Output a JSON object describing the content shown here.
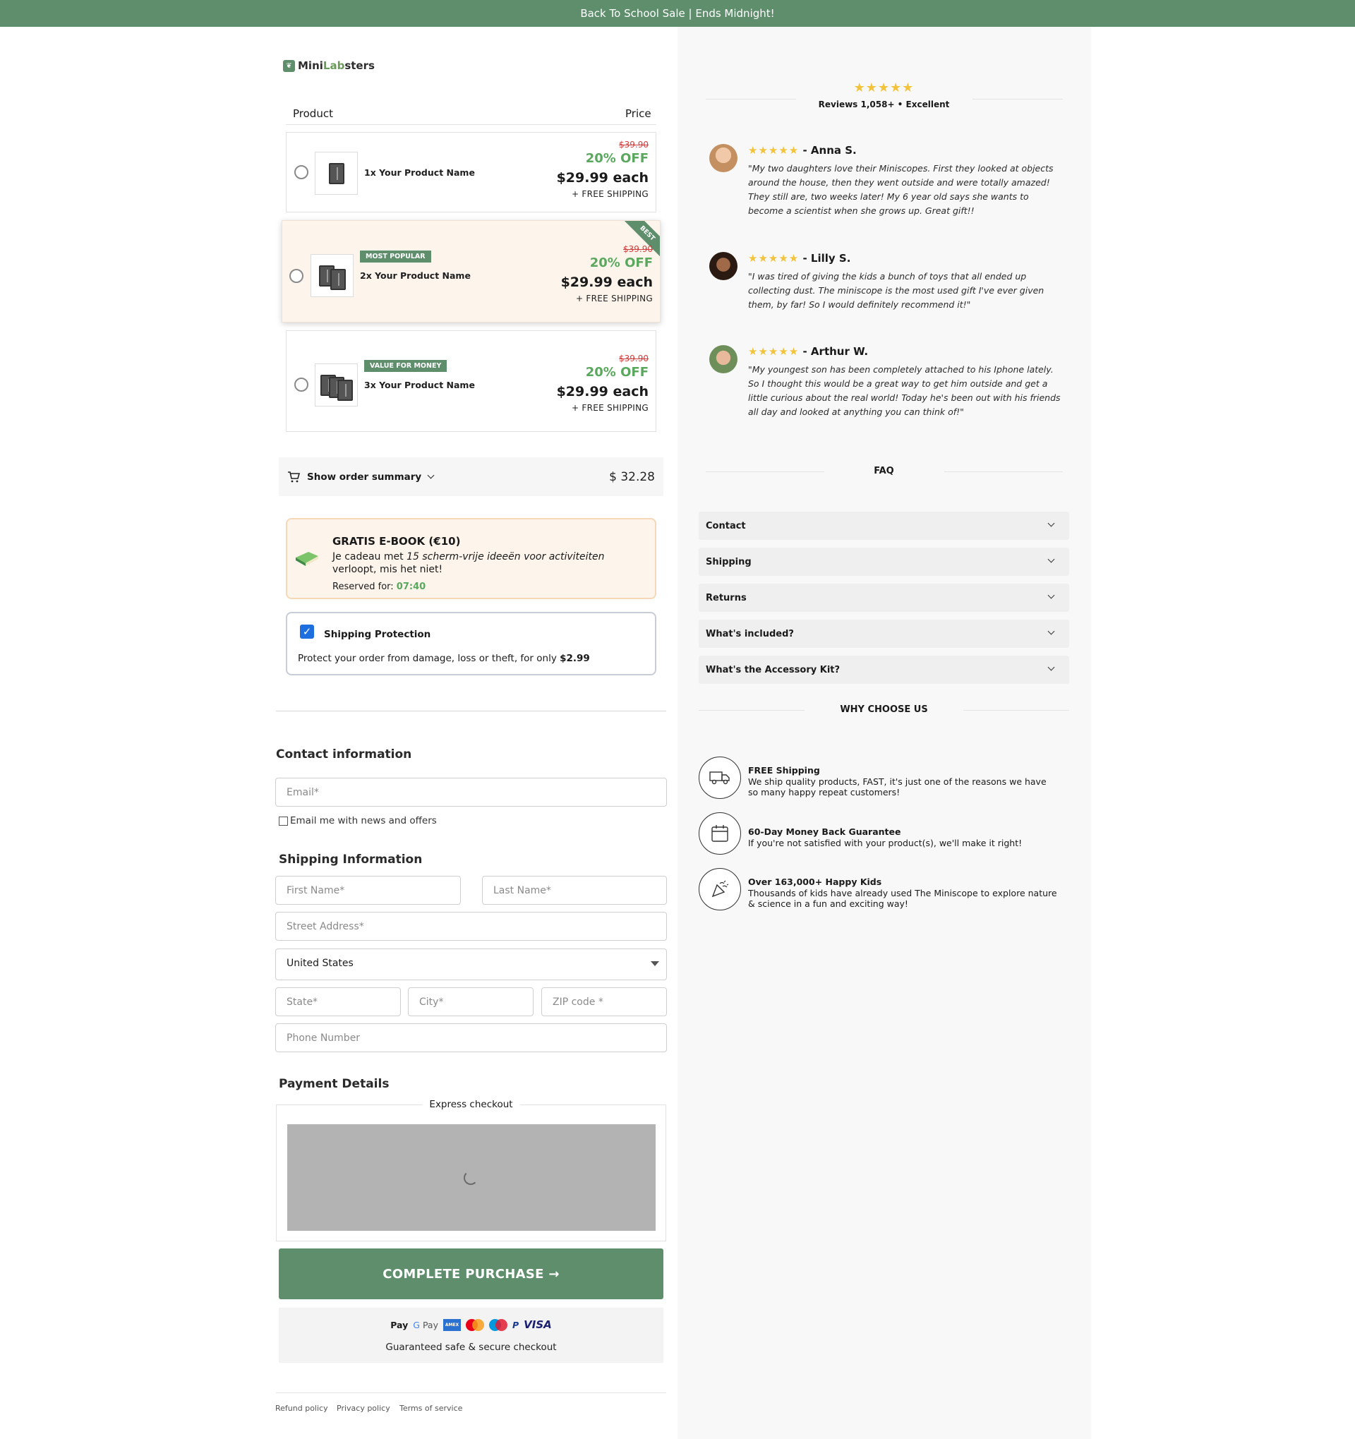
{
  "banner": "Back To School Sale | Ends Midnight!",
  "logo": {
    "mini": "Mini",
    "lab": "Lab",
    "sters": "sters"
  },
  "table": {
    "product_header": "Product",
    "price_header": "Price"
  },
  "products": [
    {
      "name": "1x Your Product Name",
      "badge": "",
      "old_price": "$39.90",
      "discount": "20% OFF",
      "price": "$29.99 each",
      "shipping": "+ FREE SHIPPING"
    },
    {
      "name": "2x Your Product Name",
      "badge": "MOST POPULAR",
      "ribbon": "BEST",
      "old_price": "$39.90",
      "discount": "20% OFF",
      "price": "$29.99 each",
      "shipping": "+ FREE SHIPPING"
    },
    {
      "name": "3x Your Product Name",
      "badge": "VALUE FOR MONEY",
      "old_price": "$39.90",
      "discount": "20% OFF",
      "price": "$29.99 each",
      "shipping": "+ FREE SHIPPING"
    }
  ],
  "summary": {
    "label": "Show order summary",
    "total": "$ 32.28"
  },
  "ebook": {
    "title": "GRATIS E-BOOK (€10)",
    "text_prefix": "Je cadeau met ",
    "text_italic": "15 scherm-vrije ideeën voor activiteiten",
    "text_suffix": " verloopt, mis het niet!",
    "reserved_label": "Reserved for: ",
    "reserved_time": "07:40"
  },
  "protection": {
    "title": "Shipping Protection",
    "desc": "Protect your order from damage, loss or theft, for only ",
    "price": "$2.99",
    "checked": true
  },
  "contact": {
    "heading": "Contact information",
    "email_placeholder": "Email*",
    "newsletter_label": "Email me with news and offers"
  },
  "shipping": {
    "heading": "Shipping Information",
    "first_name_placeholder": "First Name*",
    "last_name_placeholder": "Last Name*",
    "street_placeholder": "Street Address*",
    "country": "United States",
    "state_placeholder": "State*",
    "city_placeholder": "City*",
    "zip_placeholder": "ZIP code *",
    "phone_placeholder": "Phone Number"
  },
  "payment": {
    "heading": "Payment Details",
    "express_label": "Express checkout",
    "cta": "COMPLETE PURCHASE →",
    "methods": [
      "Apple Pay",
      "Google Pay",
      "American Express",
      "Mastercard",
      "Maestro",
      "PayPal",
      "VISA"
    ],
    "apple_pay": "Pay",
    "google_pay": "Pay",
    "amex": "AMEX",
    "paypal": "P",
    "visa": "VISA",
    "secure_caption": "Guaranteed safe & secure checkout"
  },
  "footer": {
    "refund": "Refund policy",
    "privacy": "Privacy policy",
    "terms": "Terms of service"
  },
  "reviews_summary": {
    "stars": "★★★★★",
    "text": "Reviews 1,058+ • Excellent"
  },
  "reviews": [
    {
      "stars": "★★★★★",
      "name": "- Anna S.",
      "text": "\"My two daughters love their Miniscopes. First they looked at objects around the house, then they went outside and were totally amazed! They still are, two weeks later! My 6 year old says she wants to become a scientist when she grows up. Great gift!!"
    },
    {
      "stars": "★★★★★",
      "name": "- Lilly S.",
      "text": "\"I was tired of giving the kids a bunch of toys that all ended up collecting dust. The miniscope is the most used gift I've ever given them, by far! So I would definitely recommend it!\""
    },
    {
      "stars": "★★★★★",
      "name": "- Arthur W.",
      "text": "\"My youngest son has been completely attached to his Iphone lately. So I thought this would be a great way to get him outside and get a little curious about the real world! Today he's been out with his friends all day and looked at anything you can think of!\""
    }
  ],
  "faq": {
    "heading": "FAQ",
    "items": [
      "Contact",
      "Shipping",
      "Returns",
      "What's included?",
      "What's the Accessory Kit?"
    ]
  },
  "why": {
    "heading": "WHY CHOOSE US",
    "items": [
      {
        "title": "FREE Shipping",
        "desc": "We ship quality products, FAST, it's just one of the reasons we have so many happy repeat customers!"
      },
      {
        "title": "60-Day Money Back Guarantee",
        "desc": "If you're not satisfied with your product(s), we'll make it right!"
      },
      {
        "title": "Over 163,000+ Happy Kids",
        "desc": "Thousands of kids have already used The Miniscope to explore nature & science in a fun and exciting way!"
      }
    ]
  },
  "colors": {
    "brand_green": "#5e8e6c",
    "discount_green": "#5aa85e",
    "strike_red": "#d23c3c",
    "star_gold": "#f3c33b",
    "checkbox_blue": "#1d6fe0"
  }
}
